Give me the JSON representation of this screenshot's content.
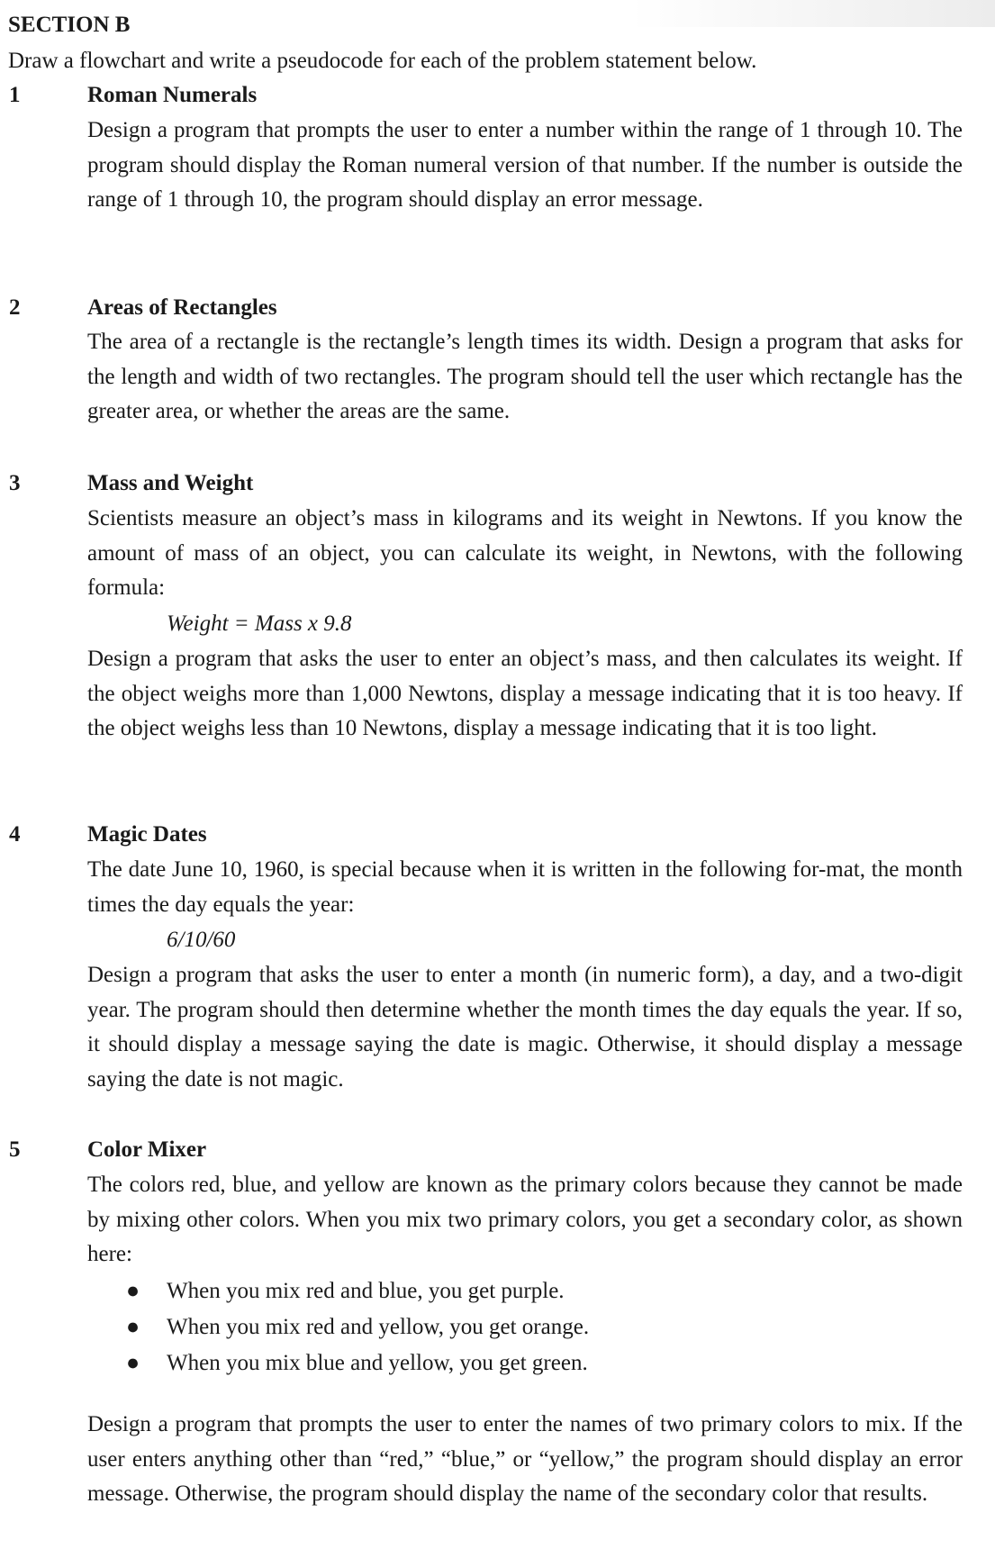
{
  "section_title": "SECTION B",
  "instruction": "Draw a flowchart and write a pseudocode for each of the problem statement below.",
  "problems": [
    {
      "number": "1",
      "title": "Roman Numerals",
      "text": "Design a program that prompts the user to enter a number within the range of 1 through 10. The program should display the Roman numeral version of that number. If the number is outside the range of 1 through 10, the program should display an error message."
    },
    {
      "number": "2",
      "title": "Areas of Rectangles",
      "text": "The area of a rectangle is the rectangle’s length times its width. Design a program that asks for the length and width of two rectangles. The program should tell the user which rectangle has the greater area, or whether the areas are the same."
    },
    {
      "number": "3",
      "title": "Mass and Weight",
      "text": "Scientists measure an object’s mass in kilograms and its weight in Newtons. If you know the amount of mass of an object, you can calculate its weight, in Newtons, with the following formula:",
      "formula": "Weight = Mass x 9.8",
      "text2": "Design a program that asks the user to enter an object’s mass, and then calculates its weight. If the object weighs more than 1,000 Newtons, display a message indicating that it is too heavy. If the object weighs less than 10 Newtons, display a message indicating that it is too light."
    },
    {
      "number": "4",
      "title": "Magic Dates",
      "text": "The date June 10, 1960, is special because when it is written in the following for-mat, the month times the day equals the year:",
      "formula": "6/10/60",
      "text2": "Design a program that asks the user to enter a month (in numeric form), a day, and a two-digit year. The program should then determine whether the month times the day equals the year. If so, it should display a message saying the date is magic. Otherwise, it should display a message saying the date is not magic."
    },
    {
      "number": "5",
      "title": "Color Mixer",
      "text": "The colors red, blue, and yellow are known as the primary colors because they cannot be made by mixing other colors. When you mix two primary colors, you get a secondary color, as shown here:",
      "bullets": [
        "When you mix red and blue, you get purple.",
        "When you mix red and yellow, you get orange.",
        "When you mix blue and yellow, you get green."
      ],
      "text2": "Design a program that prompts the user to enter the names of two primary colors to mix. If the user enters anything other than “red,” “blue,” or “yellow,” the program should display an error message. Otherwise, the program should display the name of the secondary color that results."
    }
  ]
}
